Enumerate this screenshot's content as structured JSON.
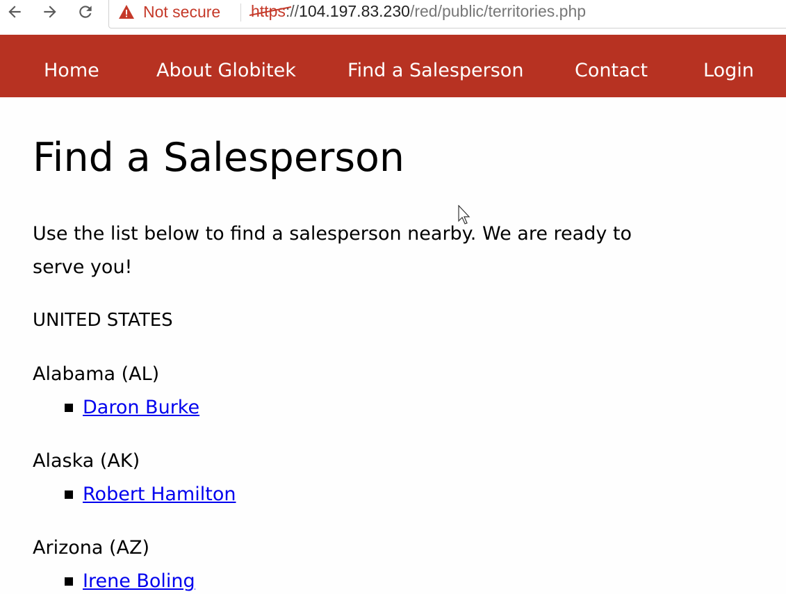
{
  "browser": {
    "security_label": "Not secure",
    "url_scheme": "https",
    "url_sep": "://",
    "url_host": "104.197.83.230",
    "url_path": "/red/public/territories.php"
  },
  "nav": {
    "items": [
      "Home",
      "About Globitek",
      "Find a Salesperson",
      "Contact",
      "Login"
    ]
  },
  "page": {
    "title": "Find a Salesperson",
    "intro": "Use the list below to find a salesperson nearby. We are ready to serve you!",
    "country": "UNITED STATES",
    "territories": [
      {
        "state": "Alabama (AL)",
        "rep": "Daron Burke"
      },
      {
        "state": "Alaska (AK)",
        "rep": "Robert Hamilton"
      },
      {
        "state": "Arizona (AZ)",
        "rep": "Irene Boling"
      }
    ]
  },
  "colors": {
    "nav_bg": "#b73222",
    "link": "#0000ee",
    "warning": "#c53929"
  }
}
